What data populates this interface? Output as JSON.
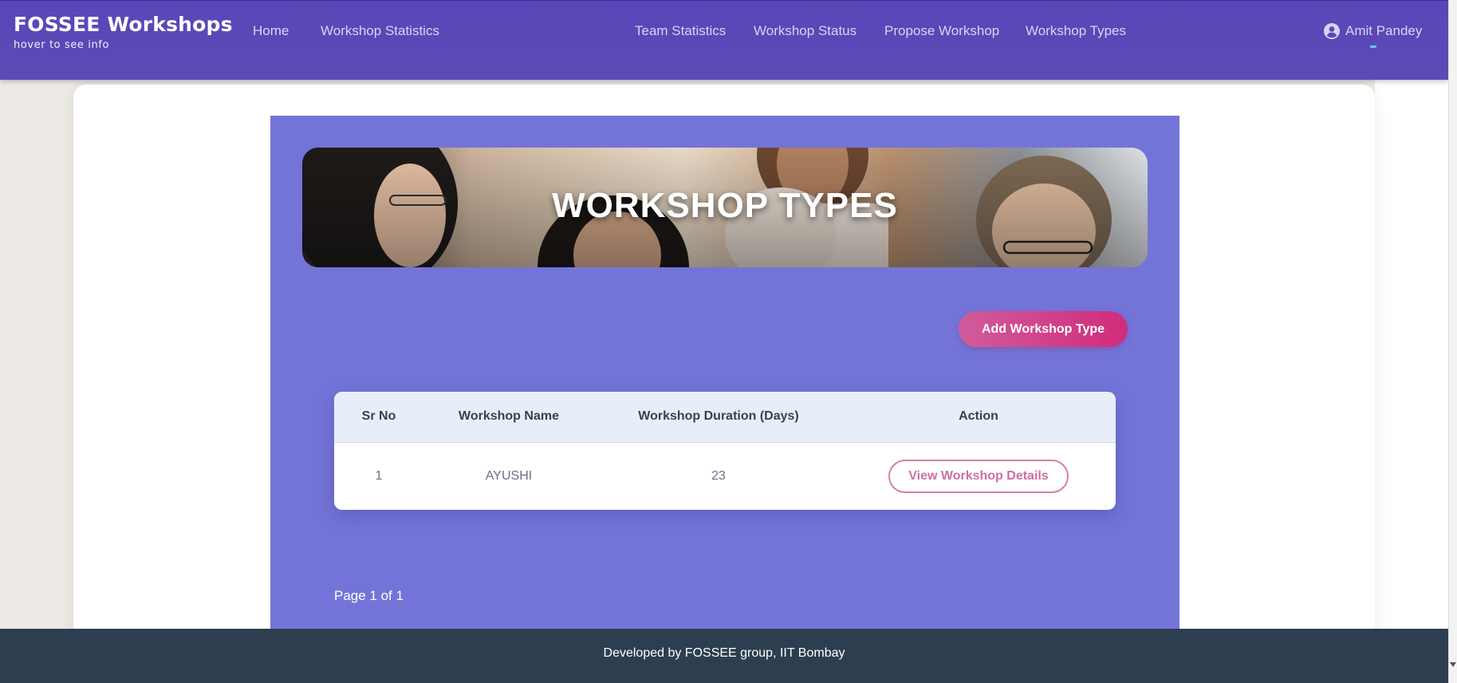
{
  "brand": {
    "title": "FOSSEE Workshops",
    "subtitle": "hover to see info"
  },
  "nav": {
    "home": "Home",
    "workshop_statistics": "Workshop Statistics",
    "team_statistics": "Team Statistics",
    "workshop_status": "Workshop Status",
    "propose_workshop": "Propose Workshop",
    "workshop_types": "Workshop Types"
  },
  "user": {
    "name": "Amit Pandey",
    "icon": "user-circle-icon"
  },
  "hero": {
    "title": "WORKSHOP TYPES"
  },
  "actions": {
    "add_workshop_type": "Add Workshop Type"
  },
  "table": {
    "headers": {
      "sr_no": "Sr No",
      "workshop_name": "Workshop Name",
      "duration": "Workshop Duration (Days)",
      "action": "Action"
    },
    "rows": [
      {
        "sr_no": "1",
        "workshop_name": "AYUSHI",
        "duration": "23",
        "action_label": "View Workshop Details"
      }
    ]
  },
  "pagination": {
    "text": "Page 1 of 1"
  },
  "footer": {
    "text": "Developed by FOSSEE group, IIT Bombay"
  },
  "colors": {
    "navbar": "#5847b8",
    "panel": "#7474d8",
    "accent_pink": "#d12b7a",
    "footer": "#2d3e50",
    "table_header": "#e7eef9"
  }
}
